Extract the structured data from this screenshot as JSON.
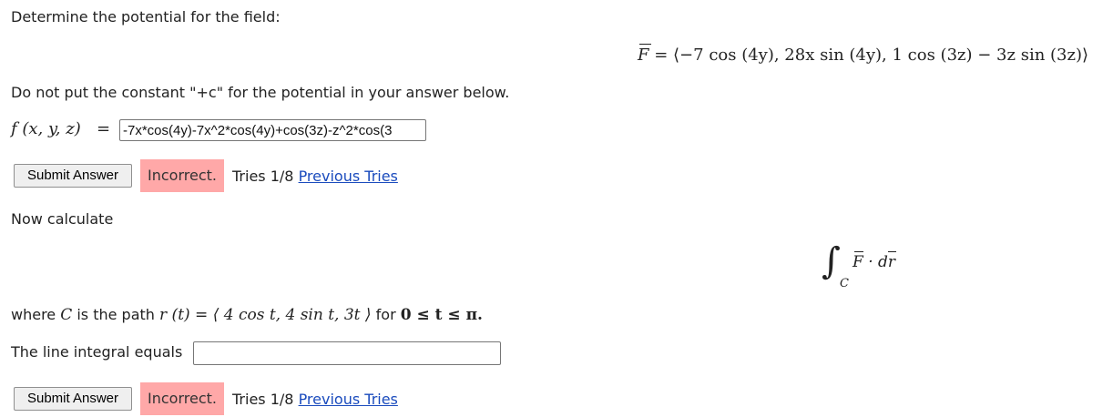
{
  "question": {
    "intro": "Determine the potential for the field:",
    "field_eq": "F⃗ = ⟨−7 cos (4y),  28x sin (4y),  1 cos (3z) − 3z sin (3z)⟩",
    "field_lhs": "F",
    "field_rhs": "= ⟨−7 cos (4y),  28x sin (4y),  1 cos (3z) − 3z sin (3z)⟩",
    "instruction": "Do not put the constant \"+c\" for the potential in your answer below.",
    "potential_label": "f (x, y, z)",
    "equals": "=",
    "potential_value": "-7x*cos(4y)-7x^2*cos(4y)+cos(3z)-z^2*cos(3"
  },
  "part1": {
    "submit_label": "Submit Answer",
    "status": "Incorrect.",
    "tries_text": "Tries 1/8",
    "previous_tries": "Previous Tries"
  },
  "part2": {
    "now_calculate": "Now calculate",
    "integral_sub": "C",
    "integral_body": "F · dr",
    "path_prefix": "where",
    "path_C": "C",
    "path_mid": "is the path",
    "path_eq": "r (t) = ⟨ 4 cos t,  4 sin t,  3t ⟩",
    "path_for": "for",
    "path_range": "0 ≤ t ≤ π.",
    "line_integral_label": "The line integral equals",
    "line_integral_value": ""
  },
  "part2_status": {
    "submit_label": "Submit Answer",
    "status": "Incorrect.",
    "tries_text": "Tries 1/8",
    "previous_tries": "Previous Tries"
  },
  "colors": {
    "incorrect_bg": "#ffa8a8",
    "link": "#1a4bbd"
  }
}
